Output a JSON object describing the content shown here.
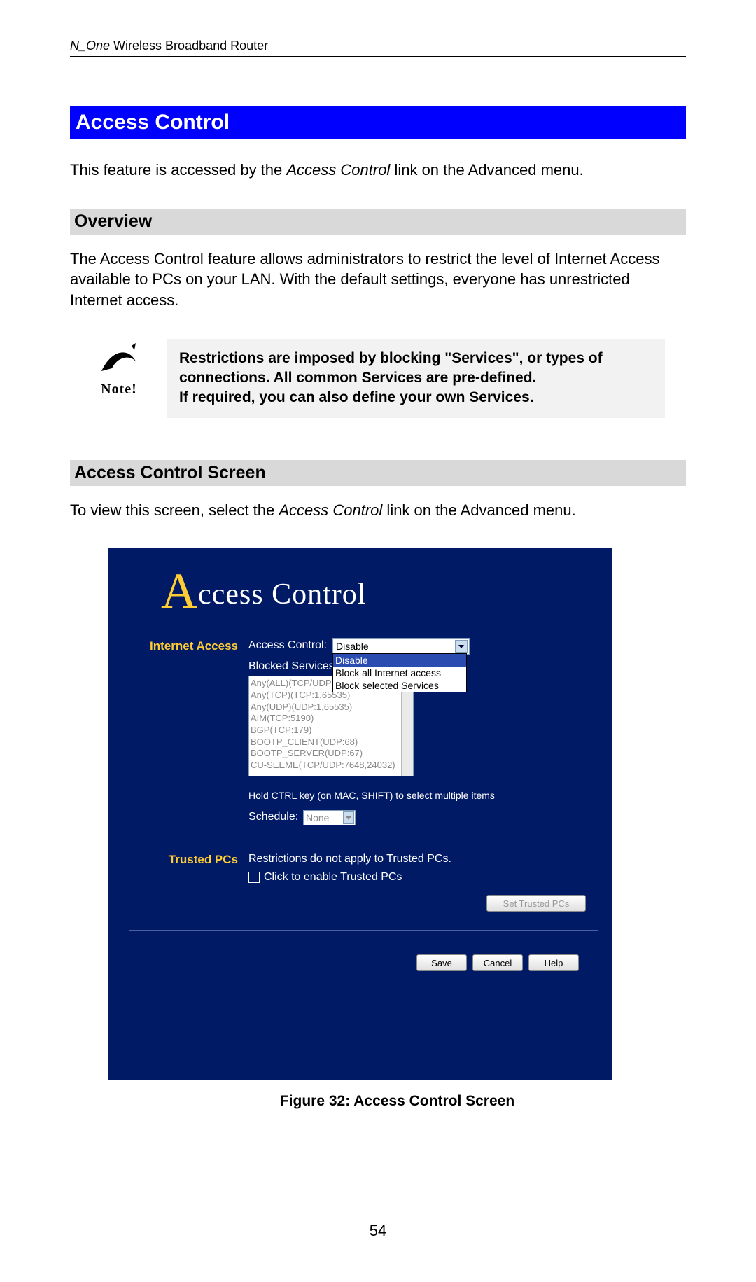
{
  "header": {
    "product_italic": "N_One",
    "product_rest": " Wireless Broadband Router"
  },
  "title": "Access Control",
  "intro": {
    "pre": "This feature is accessed by the ",
    "link": "Access Control",
    "post": " link on the Advanced menu."
  },
  "overview": {
    "heading": "Overview",
    "text": "The Access Control feature allows administrators to restrict the level of Internet Access available to PCs on your LAN. With the default settings, everyone has unrestricted Internet access."
  },
  "note": {
    "label": "Note!",
    "line1": "Restrictions are imposed by blocking \"Services\", or types of connections. All common Services are pre-defined.",
    "line2": "If required, you can also define your own Services."
  },
  "screen_section": {
    "heading": "Access Control Screen",
    "text_pre": "To view this screen, select the ",
    "text_link": "Access Control",
    "text_post": " link on the Advanced menu."
  },
  "shot": {
    "title_rest": "ccess Control",
    "left_internet": "Internet Access",
    "left_trusted": "Trusted PCs",
    "lbl_ac": "Access Control:",
    "sel_value": "Disable",
    "dd_opt1": "Disable",
    "dd_opt2": "Block all Internet access",
    "dd_opt3": "Block selected Services",
    "lbl_blocked": "Blocked Services",
    "list": [
      "Any(ALL)(TCP/UDP:1,65535)",
      "Any(TCP)(TCP:1,65535)",
      "Any(UDP)(UDP:1,65535)",
      "AIM(TCP:5190)",
      "BGP(TCP:179)",
      "BOOTP_CLIENT(UDP:68)",
      "BOOTP_SERVER(UDP:67)",
      "CU-SEEME(TCP/UDP:7648,24032)"
    ],
    "hint": "Hold CTRL key (on MAC, SHIFT) to select multiple items",
    "lbl_schedule": "Schedule:",
    "sched_val": "None",
    "trusted_text": "Restrictions do not apply to Trusted PCs.",
    "trusted_chk": "Click to enable Trusted PCs",
    "btn_set": "Set Trusted PCs",
    "btn_save": "Save",
    "btn_cancel": "Cancel",
    "btn_help": "Help"
  },
  "caption": "Figure 32: Access Control Screen",
  "pagenum": "54"
}
